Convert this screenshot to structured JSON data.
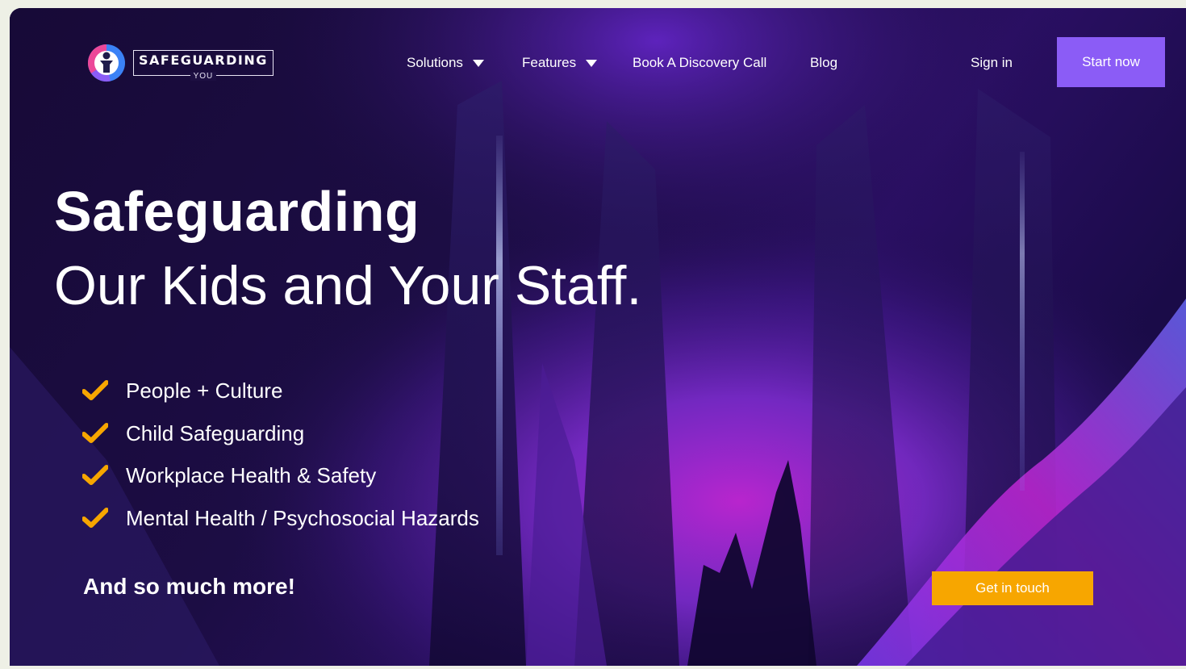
{
  "brand": {
    "name": "SAFEGUARDING",
    "sub": "YOU"
  },
  "nav": {
    "items": [
      {
        "label": "Solutions",
        "has_dropdown": true
      },
      {
        "label": "Features",
        "has_dropdown": true
      },
      {
        "label": "Book A Discovery Call",
        "has_dropdown": false
      },
      {
        "label": "Blog",
        "has_dropdown": false
      }
    ],
    "sign_in": "Sign in",
    "start_now": "Start now"
  },
  "hero": {
    "title": "Safeguarding",
    "subtitle": "Our Kids and Your Staff.",
    "features": [
      "People + Culture",
      "Child Safeguarding",
      "Workplace Health & Safety",
      "Mental Health / Psychosocial Hazards"
    ],
    "more": "And so much more!",
    "cta": "Get in touch"
  },
  "icons": {
    "logo": "person-in-circle-logo-icon",
    "check": "check-icon",
    "dropdown": "caret-down-icon"
  },
  "colors": {
    "background": "#180a3a",
    "accent_purple": "#8b5cf6",
    "accent_orange": "#f7a600",
    "check_orange": "#f7a600",
    "text": "#ffffff"
  }
}
